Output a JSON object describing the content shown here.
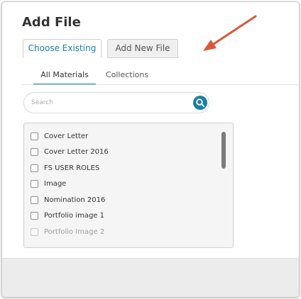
{
  "dialog": {
    "title": "Add File",
    "tabs": [
      {
        "label": "Choose Existing",
        "active": true
      },
      {
        "label": "Add New File",
        "active": false
      }
    ],
    "sub_tabs": [
      {
        "label": "All Materials",
        "active": true
      },
      {
        "label": "Collections",
        "active": false
      }
    ],
    "search": {
      "placeholder": "Search",
      "value": "",
      "icon": "search-icon"
    },
    "materials": [
      {
        "label": "Cover Letter",
        "checked": false
      },
      {
        "label": "Cover Letter 2016",
        "checked": false
      },
      {
        "label": "FS USER ROLES",
        "checked": false
      },
      {
        "label": "Image",
        "checked": false
      },
      {
        "label": "Nomination 2016",
        "checked": false
      },
      {
        "label": "Portfolio image 1",
        "checked": false
      },
      {
        "label": "Portfolio Image 2",
        "checked": false
      }
    ]
  },
  "annotation": {
    "icon": "arrow-icon",
    "color": "#d9573a"
  },
  "colors": {
    "accent": "#1b7fa6",
    "footer": "#ececec",
    "list_bg": "#f5f5f5"
  }
}
